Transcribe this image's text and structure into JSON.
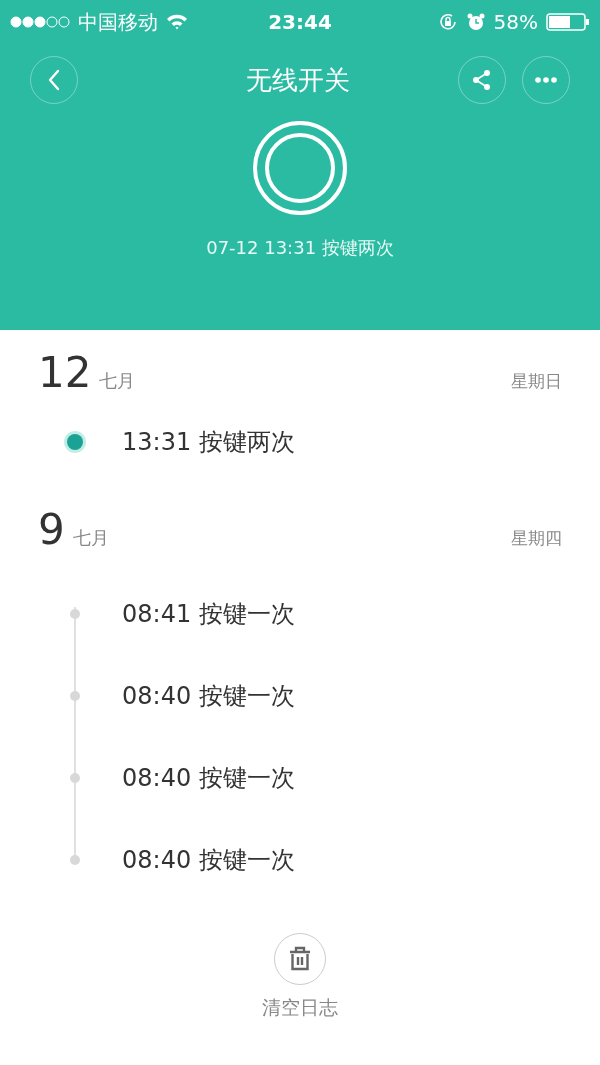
{
  "status_bar": {
    "carrier": "中国移动",
    "time": "23:44",
    "battery": "58%"
  },
  "header": {
    "title": "无线开关",
    "last_event": "07-12 13:31 按键两次"
  },
  "days": [
    {
      "day": "12",
      "month": "七月",
      "weekday": "星期日",
      "events": [
        {
          "text": "13:31 按键两次",
          "active": true
        }
      ]
    },
    {
      "day": "9",
      "month": "七月",
      "weekday": "星期四",
      "events": [
        {
          "text": "08:41 按键一次",
          "active": false
        },
        {
          "text": "08:40 按键一次",
          "active": false
        },
        {
          "text": "08:40 按键一次",
          "active": false
        },
        {
          "text": "08:40 按键一次",
          "active": false
        }
      ]
    }
  ],
  "clear_button": {
    "label": "清空日志"
  }
}
